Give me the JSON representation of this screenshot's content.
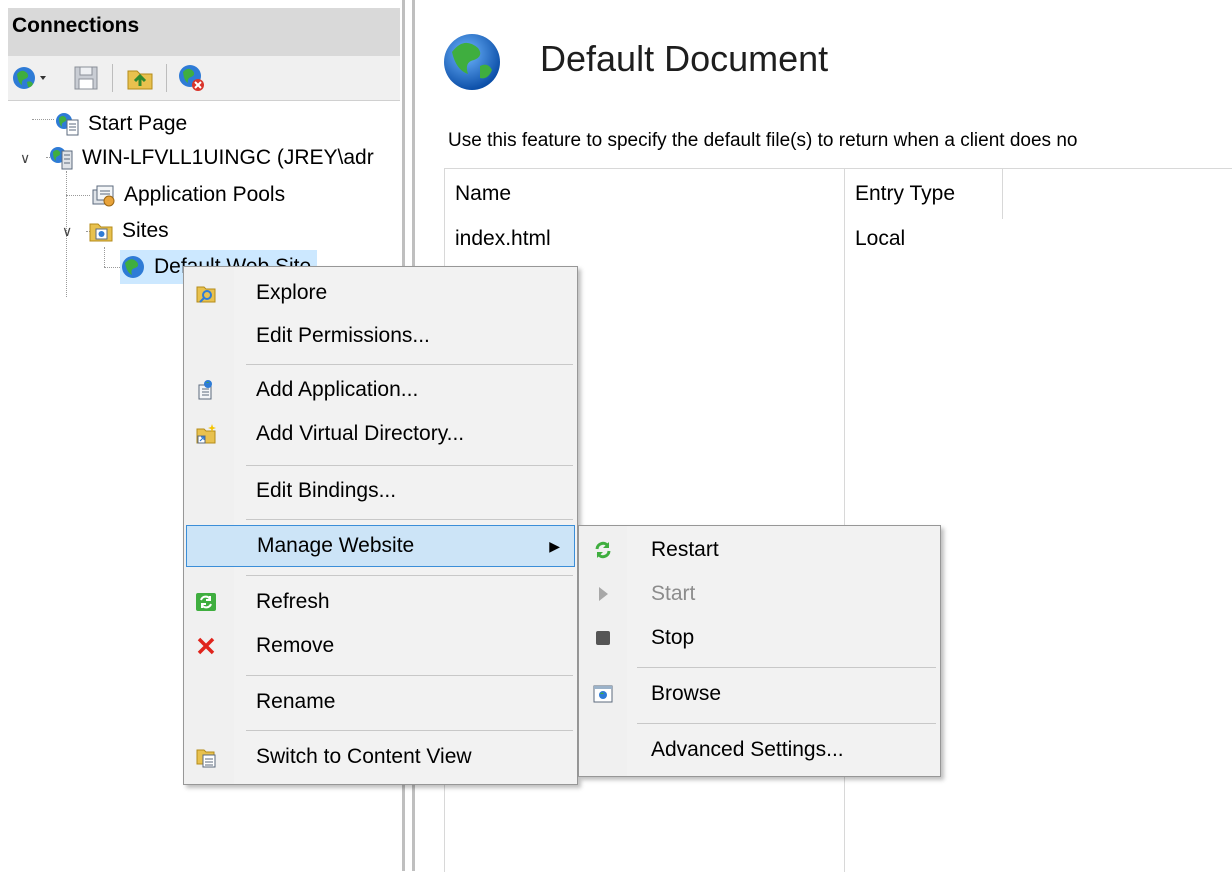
{
  "connections": {
    "title": "Connections",
    "tree": [
      {
        "label": "Start Page",
        "icon": "start-page-icon"
      },
      {
        "label": "WIN-LFVLL1UINGC (JREY\\adr",
        "icon": "server-icon"
      },
      {
        "label": "Application Pools",
        "icon": "app-pools-icon"
      },
      {
        "label": "Sites",
        "icon": "sites-folder-icon"
      },
      {
        "label": "Default Web Site",
        "icon": "globe-icon"
      }
    ]
  },
  "main": {
    "title": "Default Document",
    "description": "Use this feature to specify the default file(s) to return when a client does no",
    "columns": [
      "Name",
      "Entry Type"
    ],
    "rows": [
      {
        "name": "index.html",
        "entry_type": "Local"
      }
    ]
  },
  "context_menu": {
    "explore": "Explore",
    "edit_permissions": "Edit Permissions...",
    "add_application": "Add Application...",
    "add_virtual_directory": "Add Virtual Directory...",
    "edit_bindings": "Edit Bindings...",
    "manage_website": "Manage Website",
    "refresh": "Refresh",
    "remove": "Remove",
    "rename": "Rename",
    "switch_content_view": "Switch to Content View"
  },
  "submenu": {
    "restart": "Restart",
    "start": "Start",
    "stop": "Stop",
    "browse": "Browse",
    "advanced_settings": "Advanced Settings..."
  },
  "colors": {
    "highlight_bg": "#cce4f7",
    "highlight_border": "#3b8ed8",
    "tree_selection": "#cce8ff"
  }
}
